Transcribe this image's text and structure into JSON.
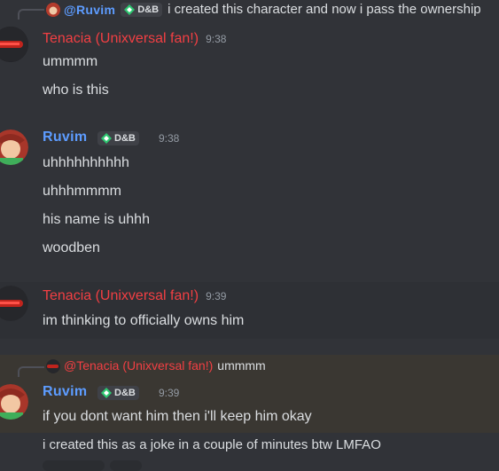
{
  "colors": {
    "background": "#313338",
    "highlight": "#2e3035",
    "reply_highlight": "#3a3732",
    "red": "#f23f43",
    "blue": "#5d9cff"
  },
  "top_reply": {
    "mention": "@Ruvim",
    "tag": "D&B",
    "text": "i created this character and now i pass the ownership"
  },
  "msg1": {
    "author": "Tenacia (Unixversal fan!)",
    "time": "9:38",
    "lines": [
      "ummmm",
      "who is this"
    ]
  },
  "msg2": {
    "author": "Ruvim",
    "tag": "D&B",
    "time": "9:38",
    "lines": [
      "uhhhhhhhhhh",
      "uhhhmmmm",
      "his name is uhhh",
      "woodben"
    ]
  },
  "msg3": {
    "author": "Tenacia (Unixversal fan!)",
    "time": "9:39",
    "lines": [
      "im thinking to officially owns him"
    ]
  },
  "reply2": {
    "mention": "@Tenacia (Unixversal fan!)",
    "text": "ummmm"
  },
  "msg4": {
    "author": "Ruvim",
    "tag": "D&B",
    "time": "9:39",
    "lines": [
      "if you dont want him then i'll keep him okay",
      "i created this as a joke in a couple of minutes btw LMFAO"
    ]
  }
}
